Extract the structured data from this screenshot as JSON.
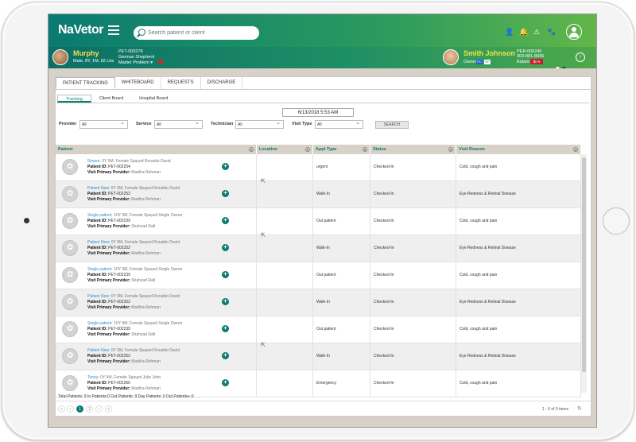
{
  "app": {
    "logo": "NaVetor",
    "search_placeholder": "Search patient or client"
  },
  "pet": {
    "name": "Murphy",
    "details": "Male, 8Y, 1M, 82 Lbs",
    "id": "PET-000279",
    "breed": "German Shepherd",
    "master_problem": "Master Problem ▾"
  },
  "owner": {
    "name": "Smith Johnson",
    "label": "Owner",
    "chips": [
      "PC",
      "RP"
    ],
    "per_id": "PER-000245",
    "phone": "303-881-8696",
    "balance_label": "Balance",
    "balance_chip": "$0 ▾"
  },
  "tabs": [
    "PATIENT TRACKING",
    "WHITEBOARD",
    "REQUESTS",
    "DISCHARGE"
  ],
  "subtabs": [
    "Tracking",
    "Client Board",
    "Hospital Board"
  ],
  "datetime": "6/13/2018 5:53 AM",
  "filters": {
    "provider_label": "Provider",
    "provider_value": "All",
    "service_label": "Service",
    "service_value": "All",
    "technician_label": "Technician",
    "technician_value": "All",
    "visit_type_label": "Visit Type",
    "visit_type_value": "All",
    "search_label": "SEARCH"
  },
  "columns": [
    "Patient",
    "Location",
    "Appt Type",
    "Status",
    "Visit Reason"
  ],
  "rows": [
    {
      "name": "Rowen:",
      "desc": " 0Y 9M, Female Spayed   Ronaldo David",
      "id_label": "Patient ID:",
      "id": " PET-002254",
      "prov_label": "Visit Primary Provider:",
      "prov": " Madiha Rehman",
      "appt": "urgent",
      "status": "Checked-In",
      "reason": "Cold, cough and pain"
    },
    {
      "name": "Patient New:",
      "desc": " 0Y 9M, Female Spayed   Ronaldo David",
      "id_label": "Patient ID:",
      "id": " PET-002252",
      "prov_label": "Visit Primary Provider:",
      "prov": " Madiha Rehman",
      "appt": "Walk-In",
      "status": "Checked-In",
      "reason": "Eye Redness & Retinal Disease"
    },
    {
      "name": "Single patient:",
      "desc": " 10Y 9M, Female Spayed   Single Owner",
      "id_label": "Patient ID:",
      "id": " PET-002239",
      "prov_label": "Visit Primary Provider:",
      "prov": " Shahzad Rafi",
      "appt": "Out patient",
      "status": "Checked-In",
      "reason": "Cold, cough and pain"
    },
    {
      "name": "Patient New:",
      "desc": " 0Y 9M, Female Spayed   Ronaldo David",
      "id_label": "Patient ID:",
      "id": " PET-002252",
      "prov_label": "Visit Primary Provider:",
      "prov": " Madiha Rehman",
      "appt": "Walk-In",
      "status": "Checked-In",
      "reason": "Eye Redness & Retinal Disease"
    },
    {
      "name": "Single patient:",
      "desc": " 10Y 9M, Female Spayed   Single Owner",
      "id_label": "Patient ID:",
      "id": " PET-002239",
      "prov_label": "Visit Primary Provider:",
      "prov": " Shahzad Rafi",
      "appt": "Out patient",
      "status": "Checked-In",
      "reason": "Cold, cough and pain"
    },
    {
      "name": "Patient New:",
      "desc": " 0Y 9M, Female Spayed   Ronaldo David",
      "id_label": "Patient ID:",
      "id": " PET-002252",
      "prov_label": "Visit Primary Provider:",
      "prov": " Madiha Rehman",
      "appt": "Walk-In",
      "status": "Checked-In",
      "reason": "Eye Redness & Retinal Disease"
    },
    {
      "name": "Single patient:",
      "desc": " 10Y 9M, Female Spayed   Single Owner",
      "id_label": "Patient ID:",
      "id": " PET-002239",
      "prov_label": "Visit Primary Provider:",
      "prov": " Shahzad Rafi",
      "appt": "Out patient",
      "status": "Checked-In",
      "reason": "Cold, cough and pain"
    },
    {
      "name": "Patient New:",
      "desc": " 0Y 9M, Female Spayed   Ronaldo David",
      "id_label": "Patient ID:",
      "id": " PET-002252",
      "prov_label": "Visit Primary Provider:",
      "prov": " Madiha Rehman",
      "appt": "Walk-In",
      "status": "Checked-In",
      "reason": "Eye Redness & Retinal Disease"
    },
    {
      "name": "Toney:",
      "desc": " 0Y 9M, Female Spayed   Julie John",
      "id_label": "Patient ID:",
      "id": " PET-002260",
      "prov_label": "Visit Primary Provider:",
      "prov": " Madiha Rehman",
      "appt": "Emergency",
      "status": "Checked-In",
      "reason": "Cold, cough and pain"
    }
  ],
  "totals": "Total Patients: 9 In Patients:0 Out Patients: 9 Day Patients: 0 Out Patients+:0",
  "pagination": {
    "first": "«",
    "prev": "‹",
    "pages": [
      "1",
      "2"
    ],
    "next": "›",
    "last": "»",
    "info": "1 - 6 of 9 items"
  },
  "colors": {
    "brand_teal": "#0a7a73",
    "brand_green": "#63b64a",
    "link_blue": "#2b8fd0"
  }
}
